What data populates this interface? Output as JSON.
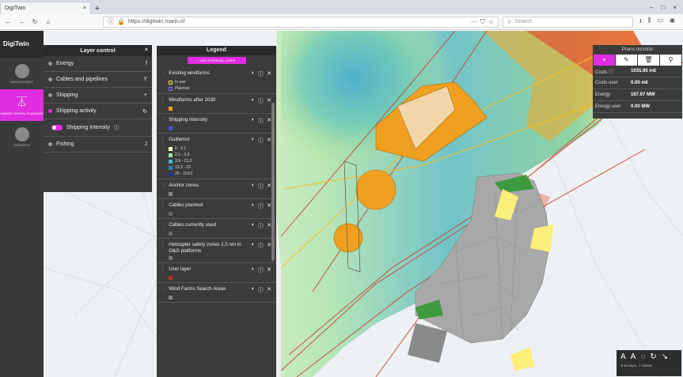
{
  "browser": {
    "tab_title": "DigiTwin",
    "tab_close": "×",
    "new_tab": "+",
    "url": "https://digitwin.marin.nl",
    "search_placeholder": "Search",
    "window_controls": [
      "–",
      "□",
      "×"
    ]
  },
  "app": {
    "brand": "DigiTwin",
    "nav": [
      {
        "label": "MANAGEMENT",
        "icon": "person-icon"
      },
      {
        "label": "MARINE SPATIAL PLANNING",
        "icon": "tower-icon",
        "active": true
      },
      {
        "label": "DATASETS",
        "icon": "database-icon"
      }
    ]
  },
  "layer_control": {
    "title": "Layer control",
    "close": "×",
    "items": [
      {
        "label": "Energy",
        "icon": "f"
      },
      {
        "label": "Cables and pipelines",
        "icon": "Y"
      },
      {
        "label": "Shipping",
        "icon": "+"
      },
      {
        "label": "Shipping activity",
        "icon": "↻",
        "active": true
      },
      {
        "label": "Fishing",
        "icon": "J"
      }
    ],
    "sub_item": "Shipping intensity",
    "sub_info": "ⓘ"
  },
  "legend": {
    "title": "Legend",
    "add_button": "+ ADD EXTERNAL LAYER",
    "items": [
      {
        "name": "Existing windfarms",
        "swatches": [
          {
            "label": "In use",
            "color": "#4a4a2a",
            "border": "#e8e04a"
          },
          {
            "label": "Planned",
            "color": "#3a3a6a",
            "border": "#7a7ad0"
          }
        ]
      },
      {
        "name": "Windfarms after 2030",
        "swatches": [
          {
            "label": "",
            "color": "#f0a020"
          }
        ]
      },
      {
        "name": "Shipping Intensity",
        "swatches": [
          {
            "label": "",
            "color": "#5050d0"
          }
        ]
      },
      {
        "name": "Guillemot",
        "swatches": [
          {
            "label": "0 - 2.1",
            "color": "#ffffcc"
          },
          {
            "label": "2.1 - 3.9",
            "color": "#a1dab4"
          },
          {
            "label": "3.9 - 13.3",
            "color": "#41b6c4"
          },
          {
            "label": "13.3 - 29",
            "color": "#2c7fb8"
          },
          {
            "label": "29 - 119.0",
            "color": "#253494"
          }
        ]
      },
      {
        "name": "Anchor zones",
        "swatches": [
          {
            "label": "",
            "color": "#888"
          }
        ]
      },
      {
        "name": "Cables planned",
        "swatches": [
          {
            "label": "",
            "color": "#666"
          }
        ]
      },
      {
        "name": "Cables currently used",
        "swatches": [
          {
            "label": "",
            "color": "#666"
          }
        ]
      },
      {
        "name": "Helicopter safety zones 2.5 nm in O&G platforms",
        "swatches": [
          {
            "label": "",
            "color": "#777"
          }
        ]
      },
      {
        "name": "User layer",
        "swatches": [
          {
            "label": "",
            "color": "#c03030"
          }
        ]
      },
      {
        "name": "Wind Farms Search Areas",
        "swatches": [
          {
            "label": "",
            "color": "#888"
          }
        ]
      }
    ]
  },
  "plans_monitor": {
    "title": "Plans monitor",
    "tools": [
      "+",
      "✎",
      "🗑",
      "⚲"
    ],
    "rows": [
      {
        "key": "Costs ⓘ",
        "value": "1035.95 m€"
      },
      {
        "key": "Costs user",
        "value": "0.00 m€"
      },
      {
        "key": "Energy",
        "value": "167.97 MW"
      },
      {
        "key": "Energy user",
        "value": "0.00 MW"
      }
    ]
  },
  "map_controls": {
    "icons": [
      "A",
      "A",
      "◌",
      "↻",
      "↘"
    ],
    "coords": "⚲ 53.00001, 7.159998"
  }
}
